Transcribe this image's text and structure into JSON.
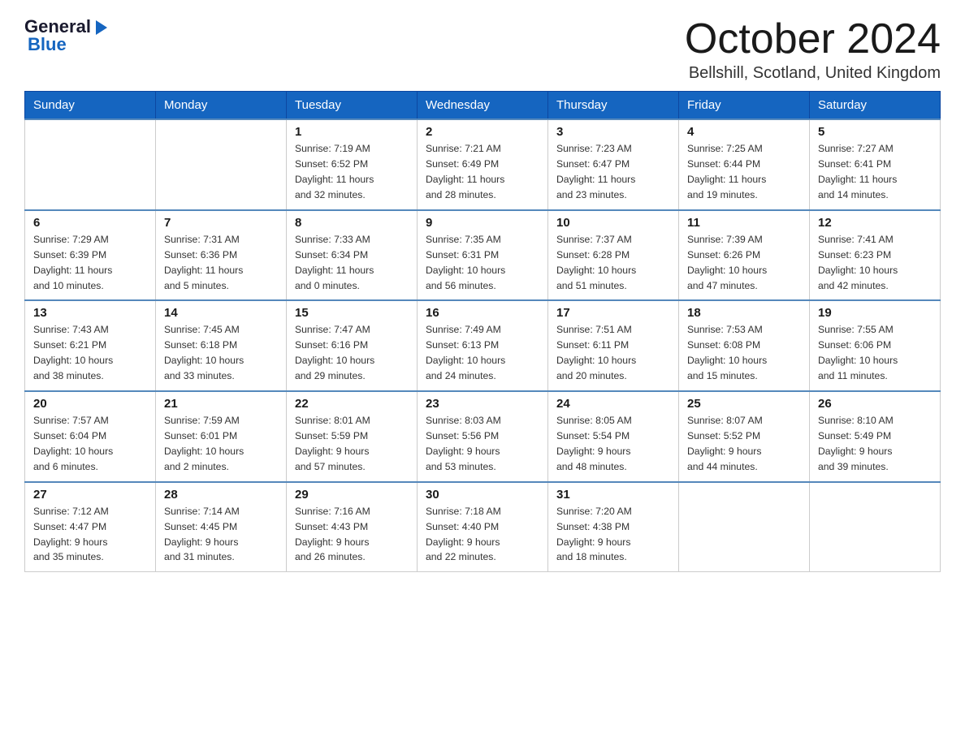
{
  "header": {
    "logo_general": "General",
    "logo_blue": "Blue",
    "month_title": "October 2024",
    "location": "Bellshill, Scotland, United Kingdom"
  },
  "weekdays": [
    "Sunday",
    "Monday",
    "Tuesday",
    "Wednesday",
    "Thursday",
    "Friday",
    "Saturday"
  ],
  "weeks": [
    [
      {
        "day": "",
        "info": ""
      },
      {
        "day": "",
        "info": ""
      },
      {
        "day": "1",
        "info": "Sunrise: 7:19 AM\nSunset: 6:52 PM\nDaylight: 11 hours\nand 32 minutes."
      },
      {
        "day": "2",
        "info": "Sunrise: 7:21 AM\nSunset: 6:49 PM\nDaylight: 11 hours\nand 28 minutes."
      },
      {
        "day": "3",
        "info": "Sunrise: 7:23 AM\nSunset: 6:47 PM\nDaylight: 11 hours\nand 23 minutes."
      },
      {
        "day": "4",
        "info": "Sunrise: 7:25 AM\nSunset: 6:44 PM\nDaylight: 11 hours\nand 19 minutes."
      },
      {
        "day": "5",
        "info": "Sunrise: 7:27 AM\nSunset: 6:41 PM\nDaylight: 11 hours\nand 14 minutes."
      }
    ],
    [
      {
        "day": "6",
        "info": "Sunrise: 7:29 AM\nSunset: 6:39 PM\nDaylight: 11 hours\nand 10 minutes."
      },
      {
        "day": "7",
        "info": "Sunrise: 7:31 AM\nSunset: 6:36 PM\nDaylight: 11 hours\nand 5 minutes."
      },
      {
        "day": "8",
        "info": "Sunrise: 7:33 AM\nSunset: 6:34 PM\nDaylight: 11 hours\nand 0 minutes."
      },
      {
        "day": "9",
        "info": "Sunrise: 7:35 AM\nSunset: 6:31 PM\nDaylight: 10 hours\nand 56 minutes."
      },
      {
        "day": "10",
        "info": "Sunrise: 7:37 AM\nSunset: 6:28 PM\nDaylight: 10 hours\nand 51 minutes."
      },
      {
        "day": "11",
        "info": "Sunrise: 7:39 AM\nSunset: 6:26 PM\nDaylight: 10 hours\nand 47 minutes."
      },
      {
        "day": "12",
        "info": "Sunrise: 7:41 AM\nSunset: 6:23 PM\nDaylight: 10 hours\nand 42 minutes."
      }
    ],
    [
      {
        "day": "13",
        "info": "Sunrise: 7:43 AM\nSunset: 6:21 PM\nDaylight: 10 hours\nand 38 minutes."
      },
      {
        "day": "14",
        "info": "Sunrise: 7:45 AM\nSunset: 6:18 PM\nDaylight: 10 hours\nand 33 minutes."
      },
      {
        "day": "15",
        "info": "Sunrise: 7:47 AM\nSunset: 6:16 PM\nDaylight: 10 hours\nand 29 minutes."
      },
      {
        "day": "16",
        "info": "Sunrise: 7:49 AM\nSunset: 6:13 PM\nDaylight: 10 hours\nand 24 minutes."
      },
      {
        "day": "17",
        "info": "Sunrise: 7:51 AM\nSunset: 6:11 PM\nDaylight: 10 hours\nand 20 minutes."
      },
      {
        "day": "18",
        "info": "Sunrise: 7:53 AM\nSunset: 6:08 PM\nDaylight: 10 hours\nand 15 minutes."
      },
      {
        "day": "19",
        "info": "Sunrise: 7:55 AM\nSunset: 6:06 PM\nDaylight: 10 hours\nand 11 minutes."
      }
    ],
    [
      {
        "day": "20",
        "info": "Sunrise: 7:57 AM\nSunset: 6:04 PM\nDaylight: 10 hours\nand 6 minutes."
      },
      {
        "day": "21",
        "info": "Sunrise: 7:59 AM\nSunset: 6:01 PM\nDaylight: 10 hours\nand 2 minutes."
      },
      {
        "day": "22",
        "info": "Sunrise: 8:01 AM\nSunset: 5:59 PM\nDaylight: 9 hours\nand 57 minutes."
      },
      {
        "day": "23",
        "info": "Sunrise: 8:03 AM\nSunset: 5:56 PM\nDaylight: 9 hours\nand 53 minutes."
      },
      {
        "day": "24",
        "info": "Sunrise: 8:05 AM\nSunset: 5:54 PM\nDaylight: 9 hours\nand 48 minutes."
      },
      {
        "day": "25",
        "info": "Sunrise: 8:07 AM\nSunset: 5:52 PM\nDaylight: 9 hours\nand 44 minutes."
      },
      {
        "day": "26",
        "info": "Sunrise: 8:10 AM\nSunset: 5:49 PM\nDaylight: 9 hours\nand 39 minutes."
      }
    ],
    [
      {
        "day": "27",
        "info": "Sunrise: 7:12 AM\nSunset: 4:47 PM\nDaylight: 9 hours\nand 35 minutes."
      },
      {
        "day": "28",
        "info": "Sunrise: 7:14 AM\nSunset: 4:45 PM\nDaylight: 9 hours\nand 31 minutes."
      },
      {
        "day": "29",
        "info": "Sunrise: 7:16 AM\nSunset: 4:43 PM\nDaylight: 9 hours\nand 26 minutes."
      },
      {
        "day": "30",
        "info": "Sunrise: 7:18 AM\nSunset: 4:40 PM\nDaylight: 9 hours\nand 22 minutes."
      },
      {
        "day": "31",
        "info": "Sunrise: 7:20 AM\nSunset: 4:38 PM\nDaylight: 9 hours\nand 18 minutes."
      },
      {
        "day": "",
        "info": ""
      },
      {
        "day": "",
        "info": ""
      }
    ]
  ]
}
